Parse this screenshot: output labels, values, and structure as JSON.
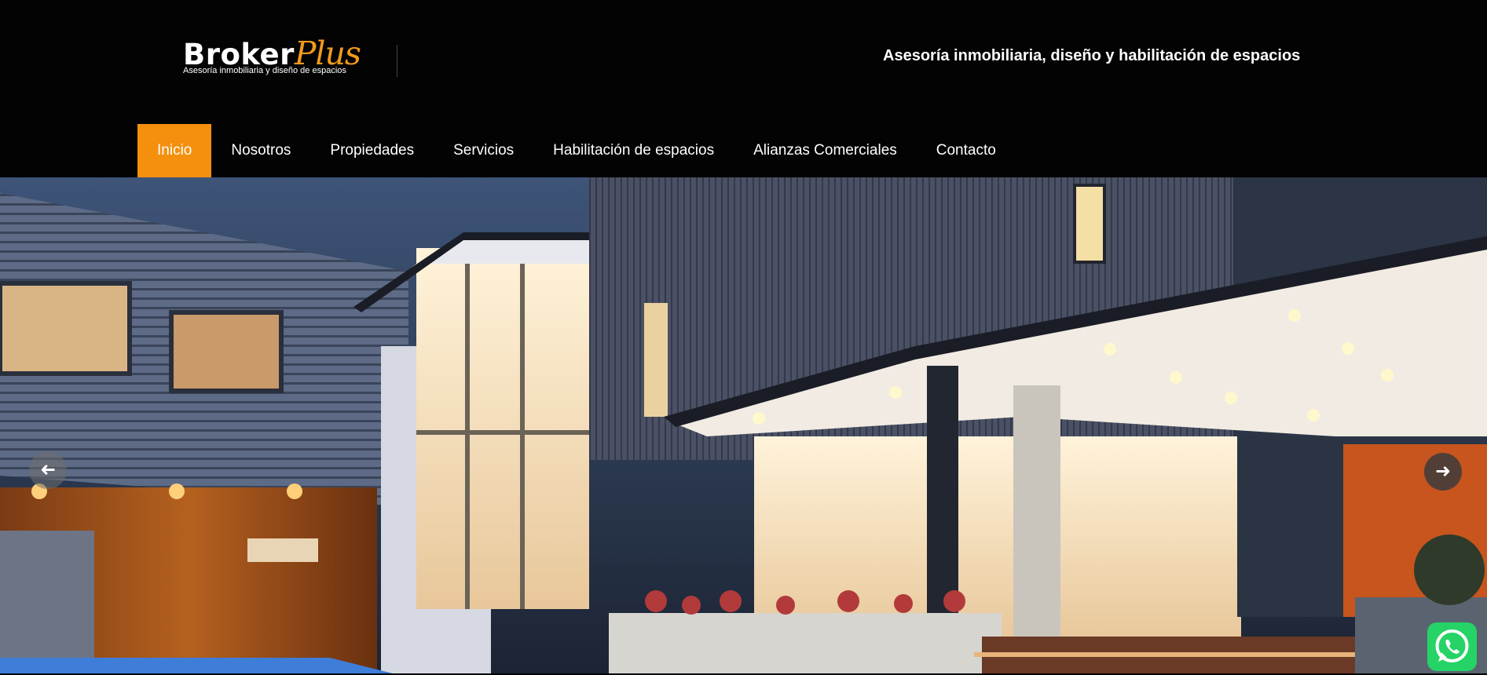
{
  "brand": {
    "name_part1": "Broker",
    "name_part2": "Plus",
    "tagline_small": "Asesoría inmobiliaria y diseño de espacios",
    "accent_color": "#f4900e"
  },
  "header": {
    "tagline": "Asesoría inmobiliaria, diseño y habilitación de espacios"
  },
  "nav": {
    "items": [
      {
        "label": "Inicio",
        "active": true
      },
      {
        "label": "Nosotros"
      },
      {
        "label": "Propiedades"
      },
      {
        "label": "Servicios"
      },
      {
        "label": "Habilitación de espacios"
      },
      {
        "label": "Alianzas Comerciales"
      },
      {
        "label": "Contacto"
      }
    ]
  },
  "slider": {
    "prev_icon": "arrow-left-icon",
    "next_icon": "arrow-right-icon",
    "prev_glyph": "➜",
    "next_glyph": "➜"
  },
  "whatsapp": {
    "icon": "whatsapp-icon",
    "color": "#25d366"
  }
}
